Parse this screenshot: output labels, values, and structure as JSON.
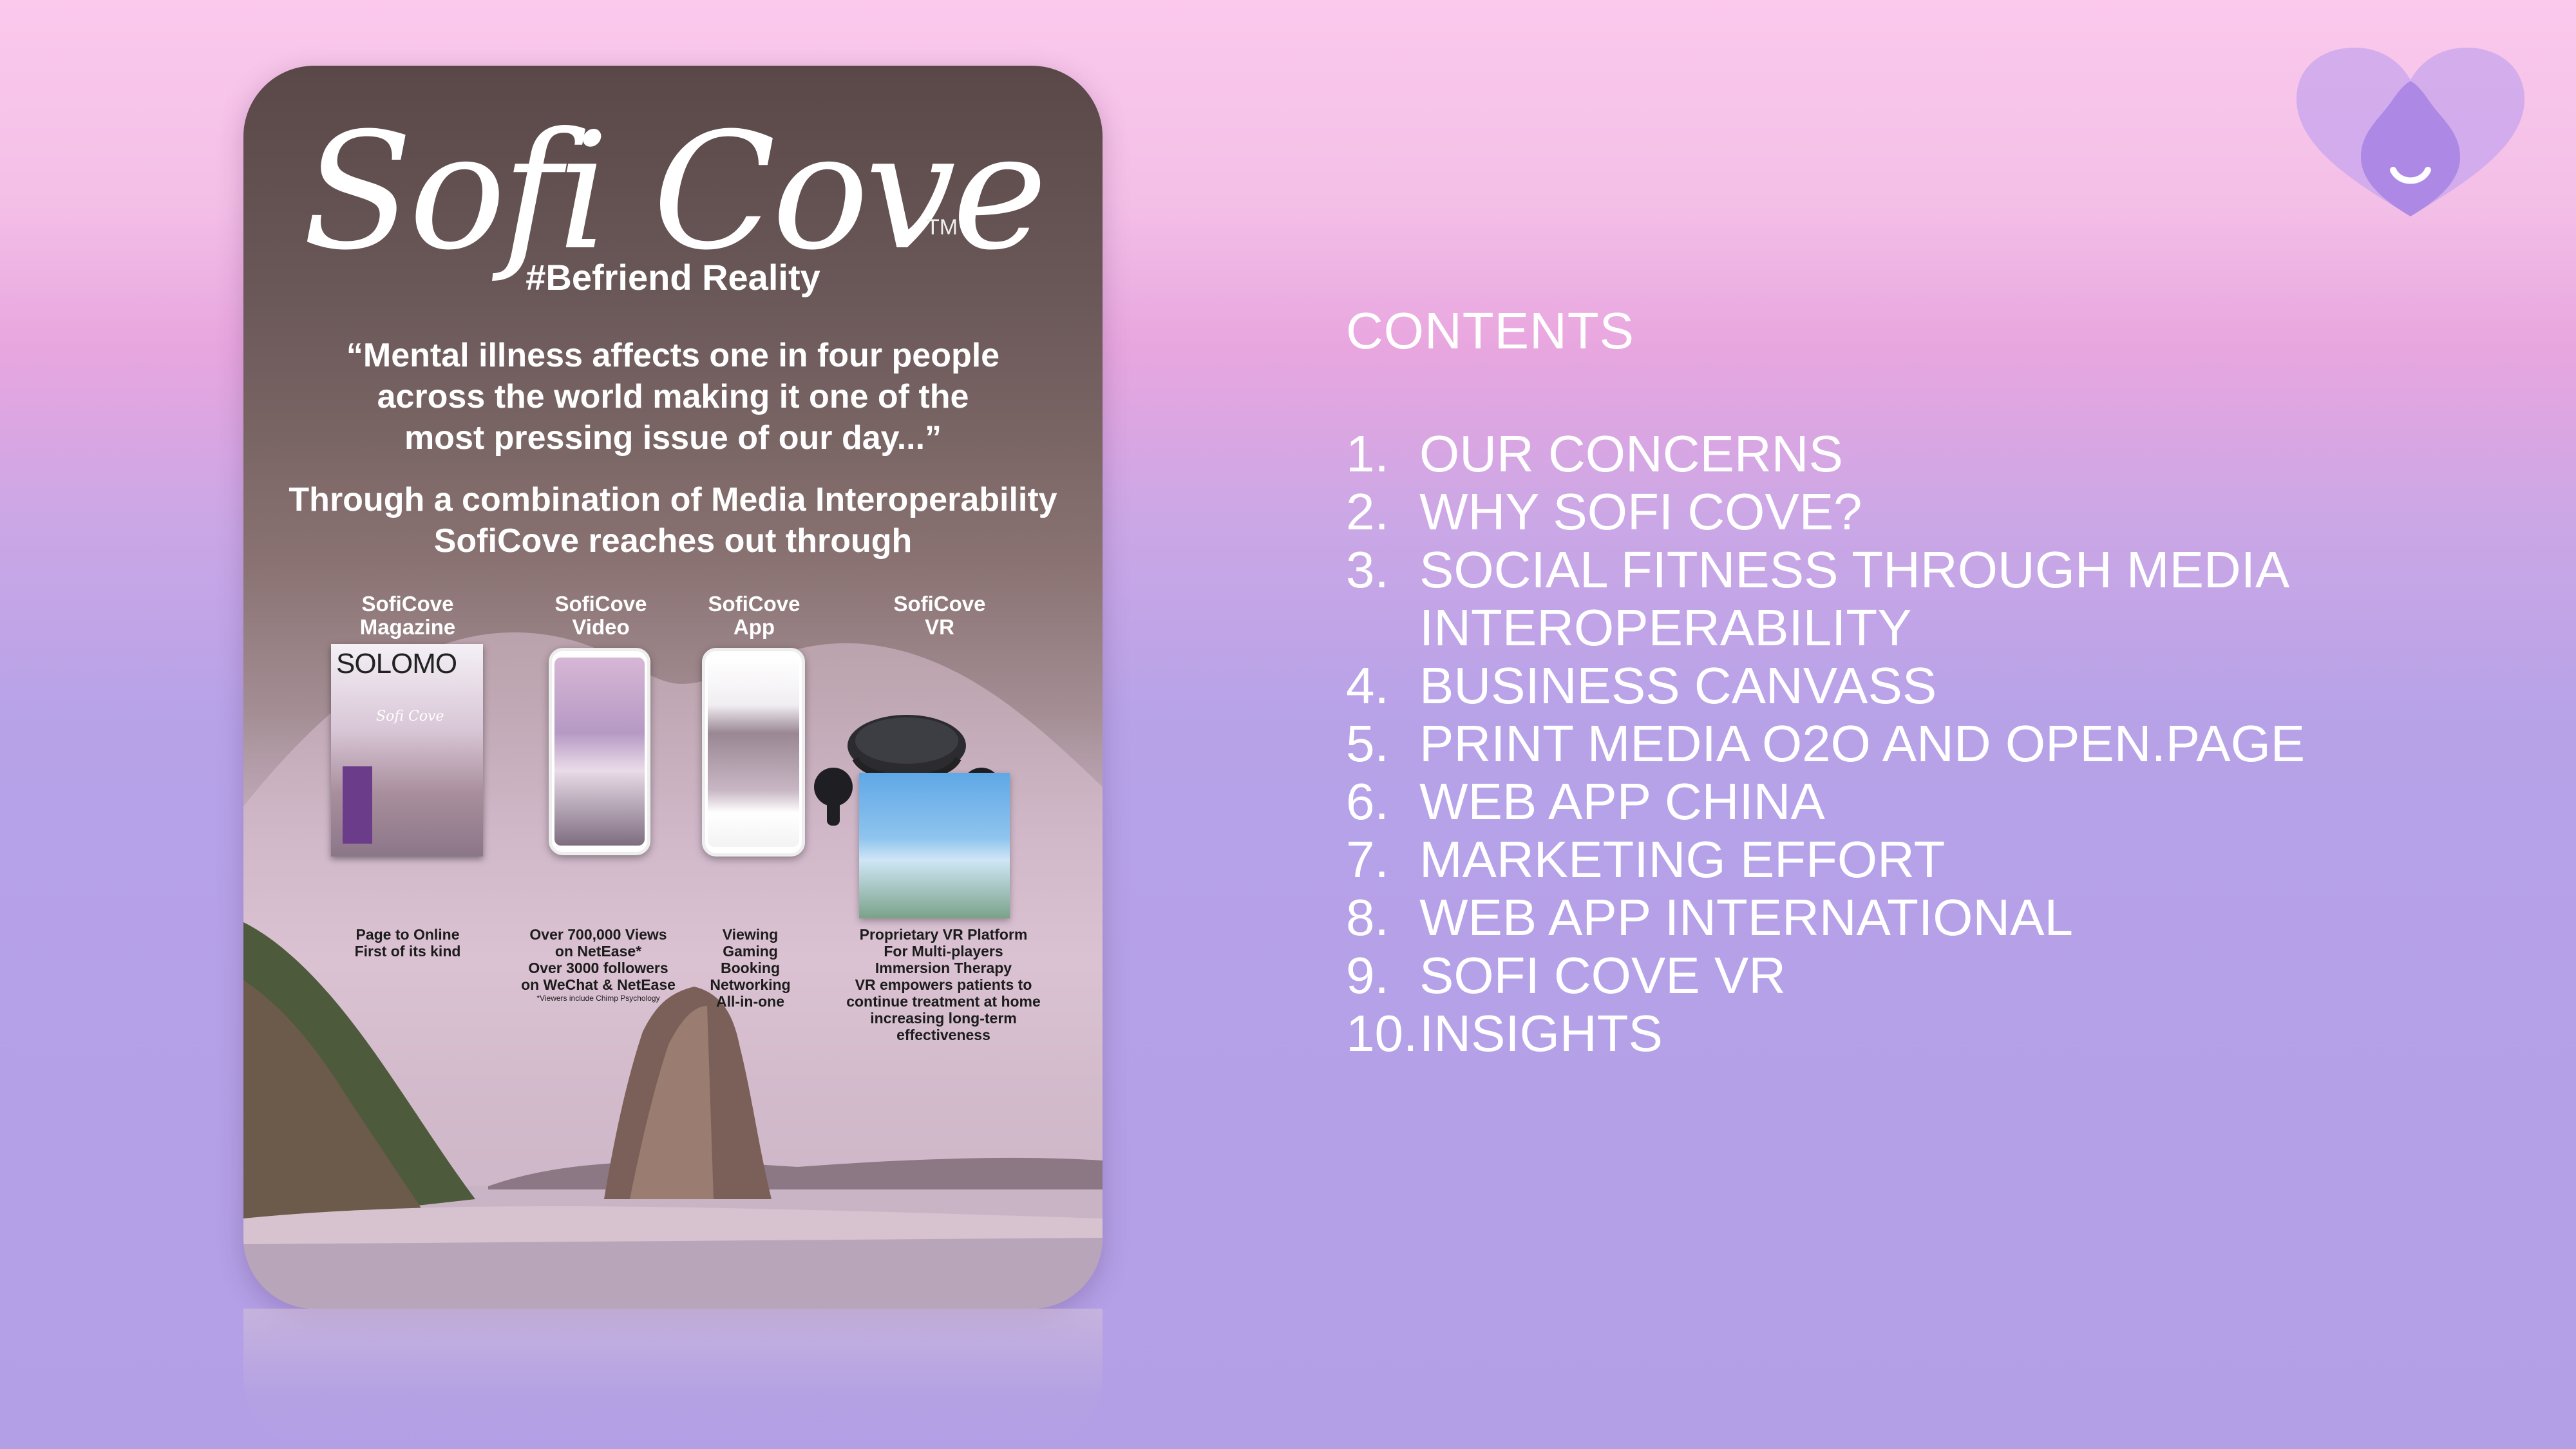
{
  "poster": {
    "logo": "Sofi Cove",
    "trademark": "TM",
    "hashtag": "#Befriend Reality",
    "quote_lines": [
      "“Mental illness affects one in four people",
      "across the world making it one of the",
      "most pressing issue of our day...”"
    ],
    "sub_lines": [
      "Through a combination of Media Interoperability",
      "SofiCove reaches out through"
    ],
    "products": [
      {
        "title_lines": [
          "SofiCove",
          "Magazine"
        ],
        "desc_lines": [
          "Page to Online",
          "First of its kind"
        ],
        "note": ""
      },
      {
        "title_lines": [
          "SofiCove",
          "Video"
        ],
        "desc_lines": [
          "Over 700,000 Views",
          "on NetEase*",
          "Over 3000 followers",
          "on WeChat & NetEase"
        ],
        "note": "*Viewers include Chimp Psychology"
      },
      {
        "title_lines": [
          "SofiCove",
          "App"
        ],
        "desc_lines": [
          "Viewing",
          "Gaming",
          "Booking",
          "Networking",
          "All-in-one"
        ],
        "note": ""
      },
      {
        "title_lines": [
          "SofiCove",
          "VR"
        ],
        "desc_lines": [
          "Proprietary VR Platform",
          "For Multi-players",
          "Immersion Therapy",
          "VR empowers patients to",
          "continue treatment at home",
          "increasing long-term",
          "effectiveness"
        ],
        "note": ""
      }
    ],
    "magazine_cover": {
      "title": "SOLOMO",
      "logo": "Sofi Cove"
    }
  },
  "contents": {
    "title": "CONTENTS",
    "items": [
      {
        "num": "1.",
        "label": "OUR CONCERNS"
      },
      {
        "num": "2.",
        "label": "WHY SOFI COVE?"
      },
      {
        "num": "3.",
        "label": "SOCIAL FITNESS THROUGH MEDIA INTEROPERABILITY"
      },
      {
        "num": "4.",
        "label": "BUSINESS CANVASS"
      },
      {
        "num": "5.",
        "label": "PRINT MEDIA O2O AND OPEN.PAGE"
      },
      {
        "num": "6.",
        "label": "WEB APP CHINA"
      },
      {
        "num": "7.",
        "label": "MARKETING EFFORT"
      },
      {
        "num": "8.",
        "label": "WEB APP INTERNATIONAL"
      },
      {
        "num": "9.",
        "label": "SOFI COVE VR"
      },
      {
        "num": "10.",
        "label": "INSIGHTS"
      }
    ]
  },
  "colors": {
    "text_light": "#ffffff",
    "heart_logo": "#b08ce6",
    "background_top": "#fbc9ec",
    "background_bottom": "#b29fe6"
  }
}
